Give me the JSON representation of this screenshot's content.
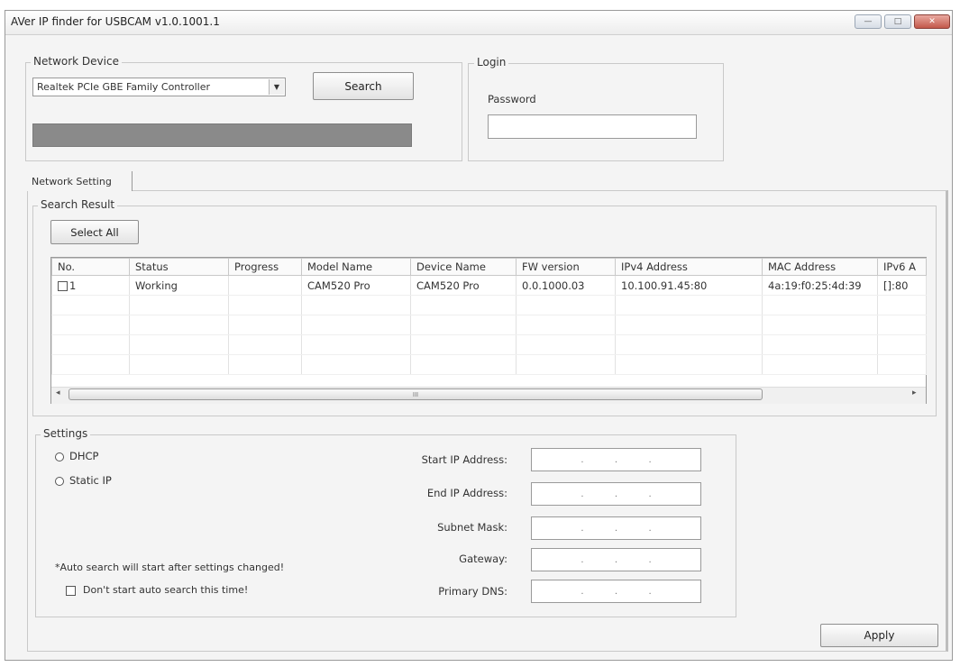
{
  "window": {
    "title": "AVer IP finder for USBCAM v1.0.1001.1",
    "minimize": "—",
    "maximize": "□",
    "close": "✕"
  },
  "network_device": {
    "label": "Network Device",
    "adapter": "Realtek PCIe GBE Family Controller",
    "search_label": "Search",
    "progress": 1.0
  },
  "login": {
    "label": "Login",
    "password_label": "Password",
    "password_value": ""
  },
  "tab": {
    "label": "Network Setting"
  },
  "search_result": {
    "label": "Search Result",
    "select_all": "Select All",
    "columns": [
      "No.",
      "Status",
      "Progress",
      "Model Name",
      "Device Name",
      "FW version",
      "IPv4 Address",
      "MAC Address",
      "IPv6 A"
    ],
    "rows": [
      {
        "no": "1",
        "status": "Working",
        "progress": "",
        "model": "CAM520 Pro",
        "device": "CAM520 Pro",
        "fw": "0.0.1000.03",
        "ipv4": "10.100.91.45:80",
        "mac": "4a:19:f0:25:4d:39",
        "ipv6": "[]:80"
      }
    ],
    "scroll_left": "◂",
    "scroll_right": "▸",
    "scroll_grip": "III"
  },
  "settings": {
    "label": "Settings",
    "dhcp": "DHCP",
    "static_ip": "Static IP",
    "note": "*Auto search will start after settings changed!",
    "dont_auto": "Don't start auto search this time!",
    "fields": [
      {
        "label": "Start IP Address:"
      },
      {
        "label": "End IP Address:"
      },
      {
        "label": "Subnet Mask:"
      },
      {
        "label": "Gateway:"
      },
      {
        "label": "Primary DNS:"
      }
    ],
    "ip_dot": "."
  },
  "apply_label": "Apply"
}
